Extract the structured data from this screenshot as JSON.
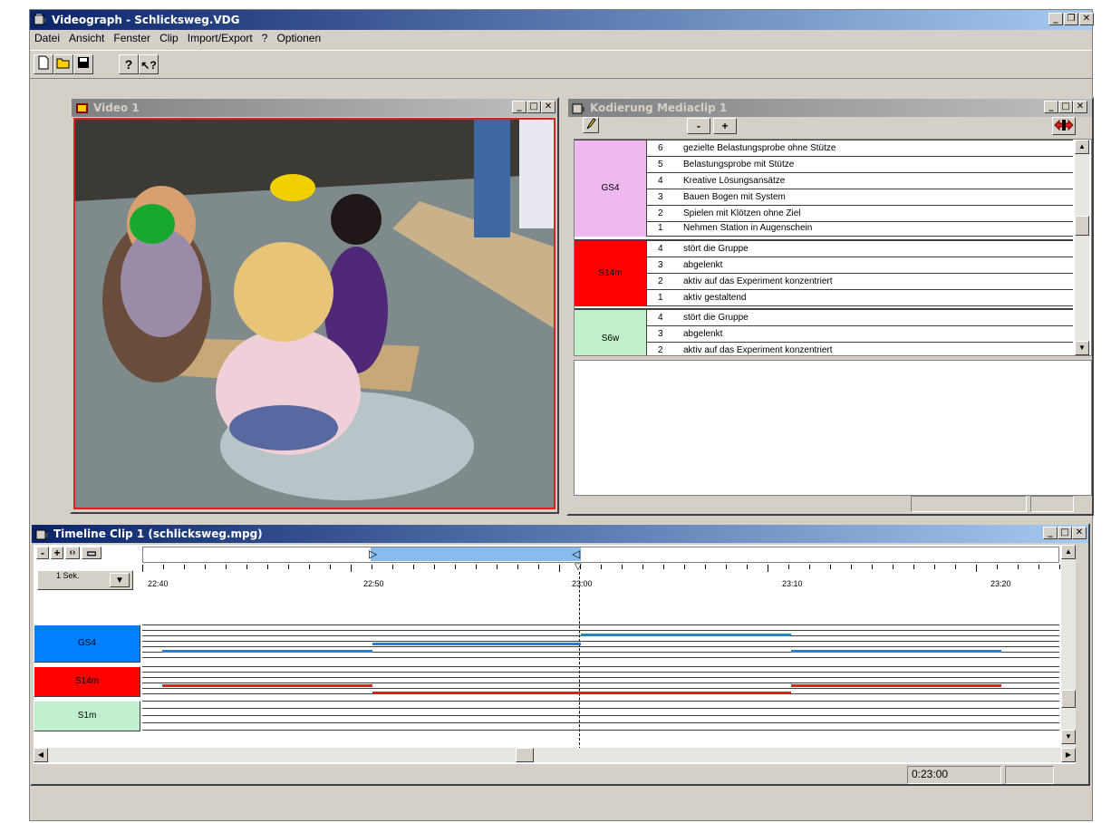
{
  "app": {
    "title": "Videograph - Schlicksweg.VDG",
    "menu": [
      "Datei",
      "Ansicht",
      "Fenster",
      "Clip",
      "Import/Export",
      "?",
      "Optionen"
    ]
  },
  "toolbar": {
    "new_icon": "new-document-icon",
    "open_icon": "open-folder-icon",
    "save_icon": "save-disk-icon",
    "help_icon": "help-icon",
    "context_help_icon": "context-help-icon"
  },
  "video_window": {
    "title": "Video 1"
  },
  "coding_window": {
    "title": "Kodierung Mediaclip 1",
    "minus_label": "-",
    "plus_label": "+",
    "groups": [
      {
        "name": "GS4",
        "color": "#f0b8f0",
        "codes": [
          {
            "num": "6",
            "text": "gezielte Belastungsprobe ohne Stütze"
          },
          {
            "num": "5",
            "text": "Belastungsprobe mit Stütze"
          },
          {
            "num": "4",
            "text": "Kreative Lösungsansätze"
          },
          {
            "num": "3",
            "text": "Bauen Bogen mit System"
          },
          {
            "num": "2",
            "text": "Spielen mit Klötzen ohne Ziel"
          },
          {
            "num": "1",
            "text": "Nehmen Station in Augenschein"
          }
        ]
      },
      {
        "name": "S14m",
        "color": "#ff0000",
        "codes": [
          {
            "num": "4",
            "text": "stört die Gruppe"
          },
          {
            "num": "3",
            "text": "abgelenkt"
          },
          {
            "num": "2",
            "text": "aktiv auf das Experiment konzentriert"
          },
          {
            "num": "1",
            "text": "aktiv gestaltend"
          }
        ]
      },
      {
        "name": "S6w",
        "color": "#c0f0c8",
        "codes": [
          {
            "num": "4",
            "text": "stört die Gruppe"
          },
          {
            "num": "3",
            "text": "abgelenkt"
          },
          {
            "num": "2",
            "text": "aktiv auf das Experiment konzentriert"
          }
        ]
      }
    ]
  },
  "timeline_window": {
    "title": "Timeline Clip 1 (schlicksweg.mpg)",
    "zoom_buttons": [
      "-",
      "+",
      "‹›",
      "▭"
    ],
    "interval_label": "1 Sek.",
    "time_labels": [
      "22:40",
      "22:50",
      "23:00",
      "23:10",
      "23:20"
    ],
    "current_time": "0:23:00",
    "tracks": [
      {
        "name": "GS4",
        "color": "#0080ff",
        "line_color": "#2080e0"
      },
      {
        "name": "S14m",
        "color": "#ff0000",
        "line_color": "#e02020"
      },
      {
        "name": "S1m",
        "color": "#c0f0d0",
        "line_color": "#000000"
      }
    ]
  }
}
